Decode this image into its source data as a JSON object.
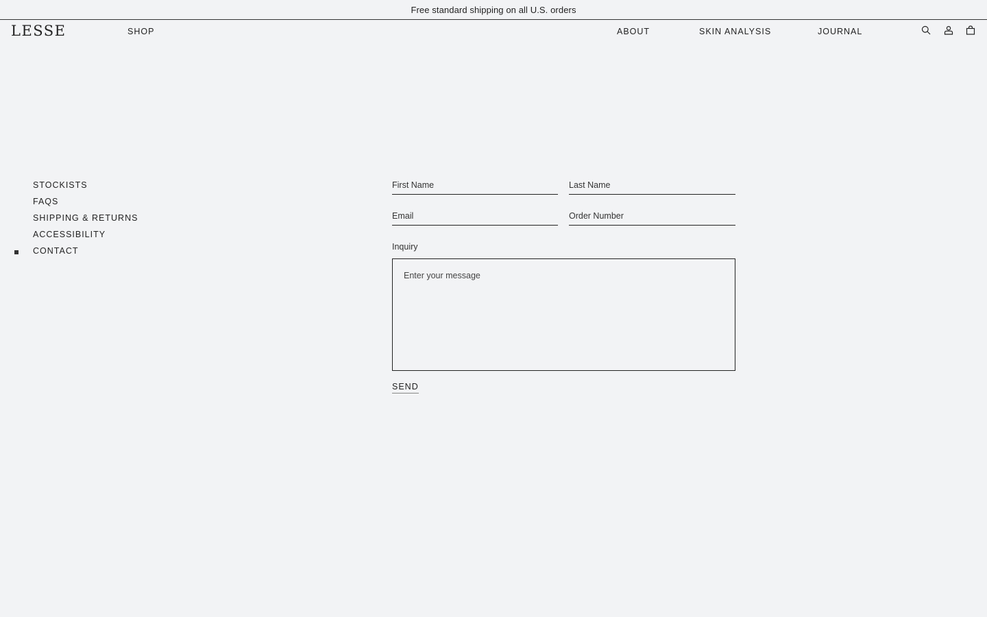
{
  "announcement": "Free standard shipping on all U.S. orders",
  "header": {
    "logo": "LESSE",
    "nav": {
      "shop": "SHOP",
      "about": "ABOUT",
      "skin_analysis": "SKIN ANALYSIS",
      "journal": "JOURNAL"
    },
    "icons": [
      "search-icon",
      "account-icon",
      "bag-icon"
    ]
  },
  "sidebar": {
    "items": [
      {
        "label": "STOCKISTS"
      },
      {
        "label": "FAQS"
      },
      {
        "label": "SHIPPING & RETURNS"
      },
      {
        "label": "ACCESSIBILITY"
      },
      {
        "label": "CONTACT",
        "active": true
      }
    ]
  },
  "form": {
    "first_name_placeholder": "First Name",
    "last_name_placeholder": "Last Name",
    "email_placeholder": "Email",
    "order_number_placeholder": "Order Number",
    "inquiry_label": "Inquiry",
    "inquiry_placeholder": "Enter your message",
    "send_label": "SEND"
  },
  "colors": {
    "background": "#f2f3f5",
    "text": "#222222"
  }
}
